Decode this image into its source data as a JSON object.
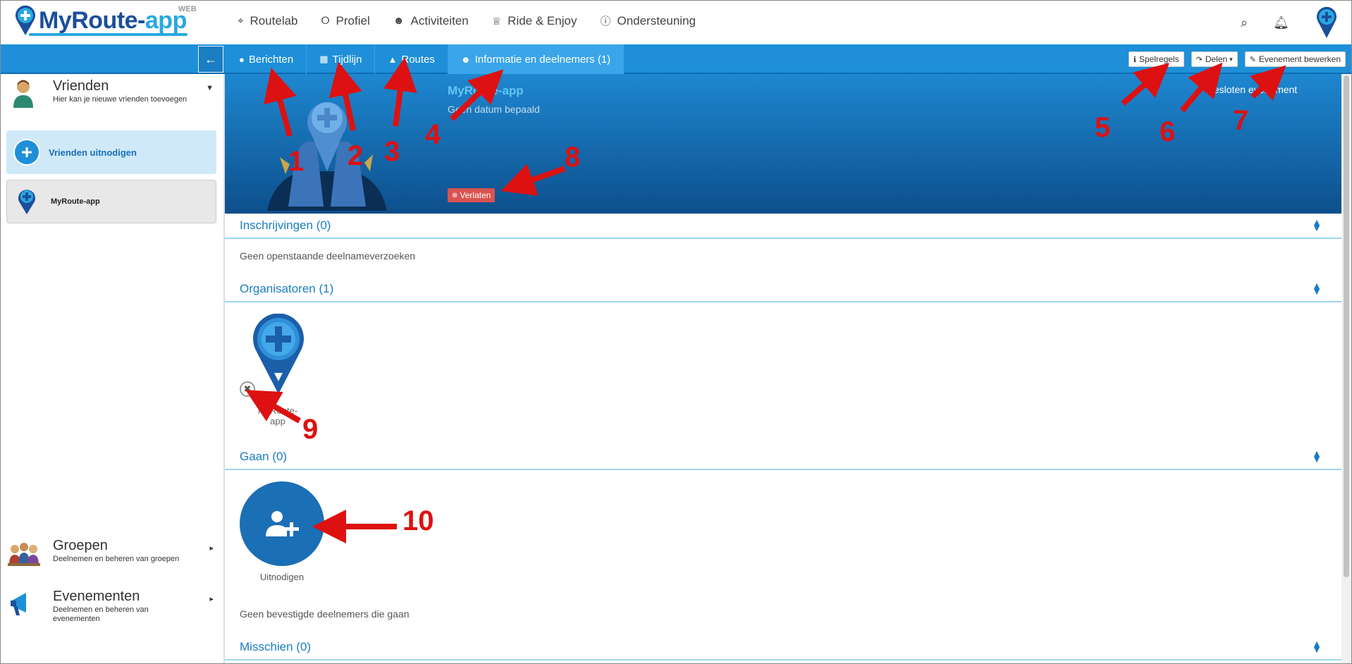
{
  "app": {
    "logo_main": "MyRoute-",
    "logo_accent": "app",
    "logo_badge": "WEB"
  },
  "topnav": [
    {
      "icon": "map-marker-icon",
      "label": "Routelab"
    },
    {
      "icon": "share-icon",
      "label": "Profiel"
    },
    {
      "icon": "users-icon",
      "label": "Activiteiten"
    },
    {
      "icon": "trophy-icon",
      "label": "Ride & Enjoy"
    },
    {
      "icon": "info-icon",
      "label": "Ondersteuning"
    }
  ],
  "tabs": [
    {
      "label": "Berichten"
    },
    {
      "label": "Tijdlijn"
    },
    {
      "label": "Routes"
    },
    {
      "label": "Informatie en deelnemers (1)"
    }
  ],
  "actions": {
    "rules": "Spelregels",
    "share": "Delen",
    "edit": "Evenement bewerken"
  },
  "sidebar": {
    "friends": {
      "title": "Vrienden",
      "subtitle": "Hier kan je nieuwe vrienden toevoegen"
    },
    "invite_label": "Vrienden uitnodigen",
    "member_label": "MyRoute-app",
    "groups": {
      "title": "Groepen",
      "subtitle": "Deelnemen en beheren van groepen"
    },
    "events": {
      "title": "Evenementen",
      "subtitle": "Deelnemen en beheren van evenementen"
    }
  },
  "banner": {
    "name": "MyRoute-app",
    "date": "Geen datum bepaald",
    "status": "Gesloten evenement",
    "leave": "Verlaten"
  },
  "sections": {
    "registrations": {
      "title": "Inschrijvingen (0)",
      "empty": "Geen openstaande deelnameverzoeken"
    },
    "organizers": {
      "title": "Organisatoren (1)",
      "member_name": "MyRoute-app"
    },
    "going": {
      "title": "Gaan (0)",
      "invite": "Uitnodigen",
      "empty": "Geen bevestigde deelnemers die gaan"
    },
    "maybe": {
      "title": "Misschien (0)"
    }
  },
  "annotations": [
    "1",
    "2",
    "3",
    "4",
    "5",
    "6",
    "7",
    "8",
    "9",
    "10"
  ],
  "colors": {
    "primary": "#1e8fd8",
    "dark_blue": "#1b6fb5",
    "danger": "#d9534f",
    "annotation": "#dd1111"
  }
}
